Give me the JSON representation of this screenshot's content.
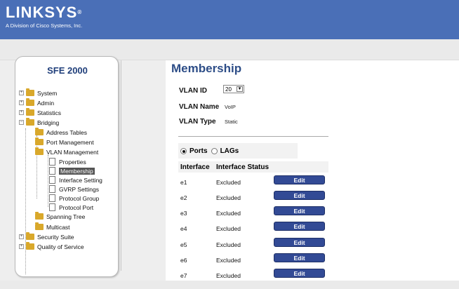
{
  "brand": {
    "name": "LINKSYS",
    "mark": "®",
    "tagline": "A Division of Cisco Systems, Inc."
  },
  "product": "SFE 2000",
  "colors": {
    "topbar": "#4a6fb7",
    "title": "#2d4d87",
    "button": "#324a95"
  },
  "nav": {
    "system": "System",
    "admin": "Admin",
    "statistics": "Statistics",
    "bridging": "Bridging",
    "address_tables": "Address Tables",
    "port_management": "Port Management",
    "vlan_management": "VLAN Management",
    "properties": "Properties",
    "membership": "Membership",
    "interface_setting": "Interface Setting",
    "gvrp_settings": "GVRP Settings",
    "protocol_group": "Protocol Group",
    "protocol_port": "Protocol Port",
    "spanning_tree": "Spanning Tree",
    "multicast": "Multicast",
    "security_suite": "Security Suite",
    "qos": "Quality of Service"
  },
  "page": {
    "title": "Membership",
    "vlan_id_label": "VLAN ID",
    "vlan_id_value": "20",
    "vlan_name_label": "VLAN Name",
    "vlan_name_value": "VoIP",
    "vlan_type_label": "VLAN Type",
    "vlan_type_value": "Static",
    "radio_ports": "Ports",
    "radio_lags": "LAGs"
  },
  "table": {
    "headers": {
      "interface": "Interface",
      "status": "Interface Status"
    },
    "rows": [
      {
        "interface": "e1",
        "status": "Excluded",
        "action": "Edit"
      },
      {
        "interface": "e2",
        "status": "Excluded",
        "action": "Edit"
      },
      {
        "interface": "e3",
        "status": "Excluded",
        "action": "Edit"
      },
      {
        "interface": "e4",
        "status": "Excluded",
        "action": "Edit"
      },
      {
        "interface": "e5",
        "status": "Excluded",
        "action": "Edit"
      },
      {
        "interface": "e6",
        "status": "Excluded",
        "action": "Edit"
      },
      {
        "interface": "e7",
        "status": "Excluded",
        "action": "Edit"
      }
    ]
  }
}
